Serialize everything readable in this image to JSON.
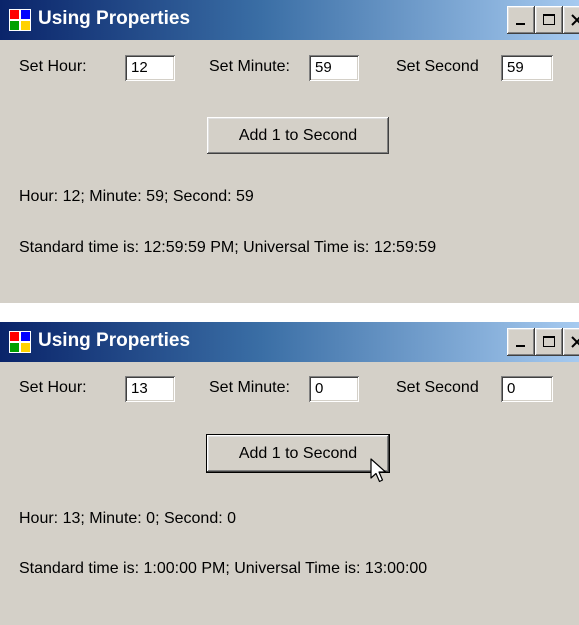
{
  "windows": [
    {
      "title": "Using Properties",
      "labels": {
        "hour": "Set Hour:",
        "minute": "Set Minute:",
        "second": "Set Second"
      },
      "values": {
        "hour": "12",
        "minute": "59",
        "second": "59"
      },
      "button": "Add 1 to Second",
      "time_line": "Hour: 12; Minute: 59; Second: 59",
      "standard_line": "Standard time is: 12:59:59 PM; Universal Time is: 12:59:59"
    },
    {
      "title": "Using Properties",
      "labels": {
        "hour": "Set Hour:",
        "minute": "Set Minute:",
        "second": "Set Second"
      },
      "values": {
        "hour": "13",
        "minute": "0",
        "second": "0"
      },
      "button": "Add 1 to Second",
      "time_line": "Hour: 13; Minute: 0; Second: 0",
      "standard_line": "Standard time is: 1:00:00 PM; Universal Time is: 13:00:00"
    }
  ],
  "colors": {
    "titlebar_start": "#0a246a",
    "titlebar_end": "#a6caf0",
    "window_bg": "#d4d0c8"
  },
  "icons": {
    "app": "app-icon",
    "minimize": "minimize-icon",
    "maximize": "maximize-icon",
    "close": "close-icon",
    "cursor": "mouse-cursor-icon"
  }
}
